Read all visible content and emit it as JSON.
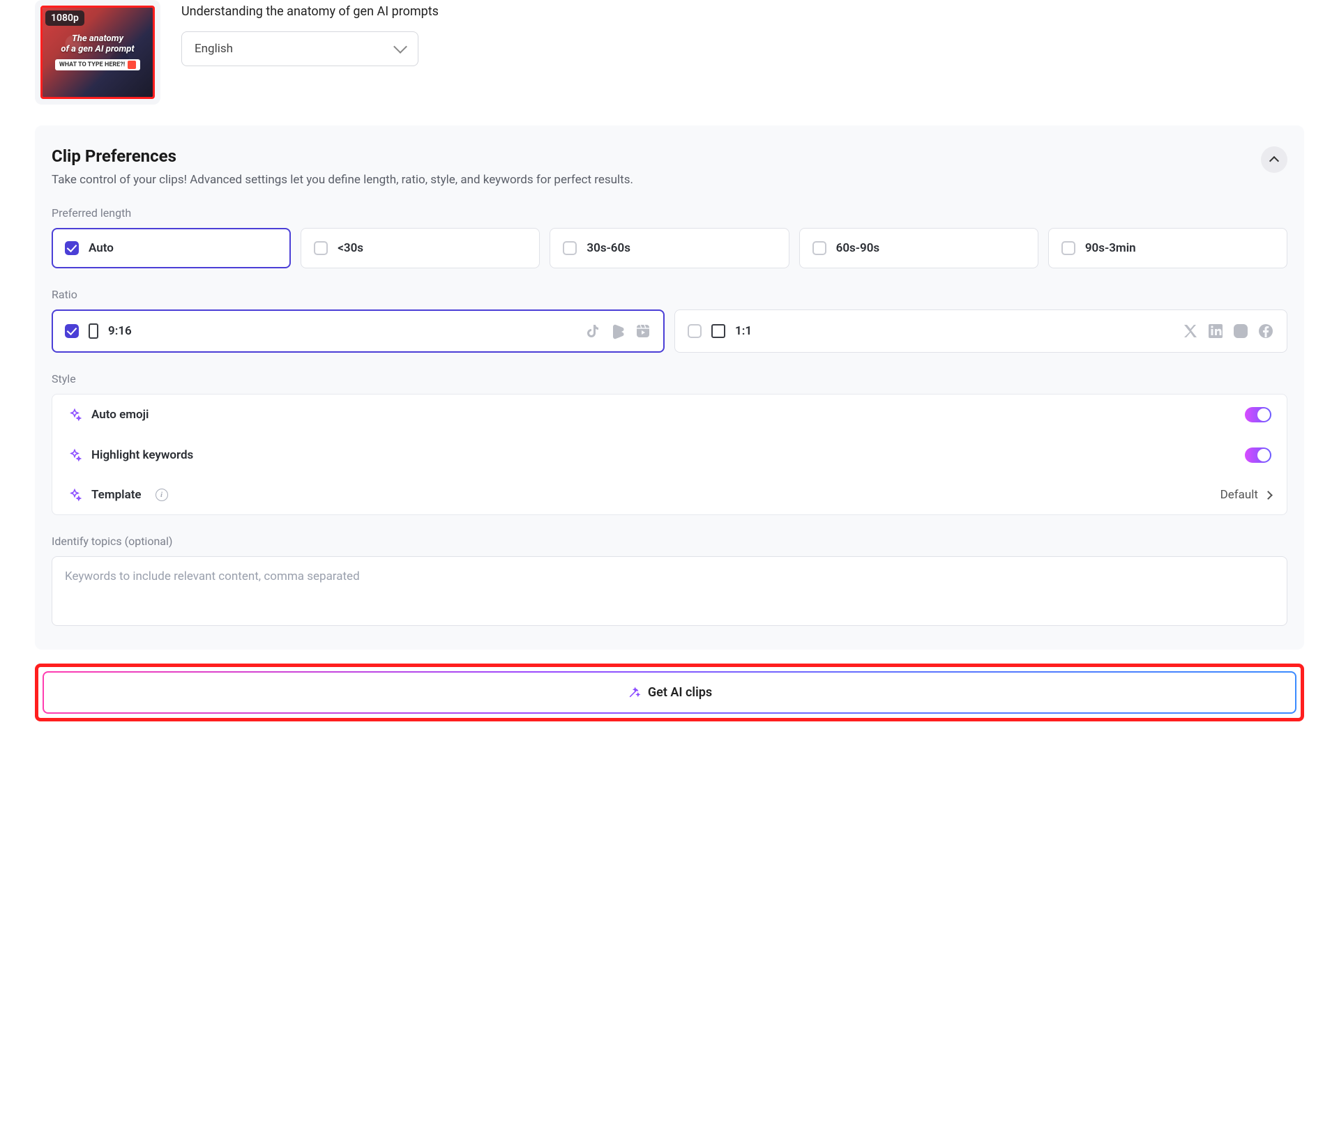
{
  "video": {
    "title": "Understanding the anatomy of gen AI prompts",
    "resolution_badge": "1080p",
    "thumb_overlay_line1": "The anatomy",
    "thumb_overlay_line2": "of a gen AI prompt",
    "thumb_tag": "WHAT TO TYPE HERE?!"
  },
  "language": {
    "selected": "English"
  },
  "prefs": {
    "heading": "Clip Preferences",
    "subheading": "Take control of your clips! Advanced settings let you define length, ratio, style, and keywords for perfect results.",
    "length_label": "Preferred length",
    "length_options": {
      "auto": {
        "label": "Auto",
        "checked": true
      },
      "lt30": {
        "label": "<30s",
        "checked": false
      },
      "s3060": {
        "label": "30s-60s",
        "checked": false
      },
      "s6090": {
        "label": "60s-90s",
        "checked": false
      },
      "s90180": {
        "label": "90s-3min",
        "checked": false
      }
    },
    "ratio_label": "Ratio",
    "ratio_options": {
      "r916": {
        "label": "9:16",
        "checked": true
      },
      "r11": {
        "label": "1:1",
        "checked": false
      }
    },
    "style_label": "Style",
    "style": {
      "auto_emoji": {
        "label": "Auto emoji",
        "on": true
      },
      "highlight_kw": {
        "label": "Highlight keywords",
        "on": true
      },
      "template": {
        "label": "Template",
        "value": "Default"
      }
    },
    "topics_label": "Identify topics (optional)",
    "topics_placeholder": "Keywords to include relevant content, comma separated"
  },
  "cta": {
    "label": "Get AI clips"
  }
}
